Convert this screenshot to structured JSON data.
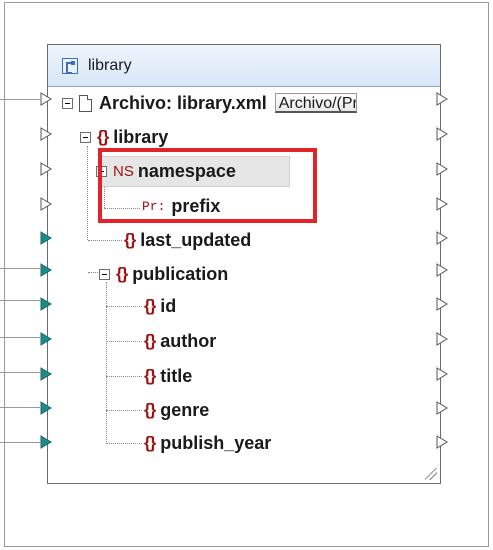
{
  "component": {
    "title": "library",
    "file_label": "Archivo: library.xml",
    "file_button": "Archivo/(Predeterminado)",
    "nodes": {
      "root": "library",
      "namespace_tag": "NS",
      "namespace": "namespace",
      "prefix_tag": "Pr:",
      "prefix": "prefix",
      "last_updated": "last_updated",
      "publication": "publication",
      "id": "id",
      "author": "author",
      "title": "title",
      "genre": "genre",
      "publish_year": "publish_year"
    }
  },
  "colors": {
    "element_icon": "#a01212",
    "highlight_border": "#e0242a",
    "connected_port": "#1f8a8a",
    "title_bar": "#dce9f7"
  }
}
